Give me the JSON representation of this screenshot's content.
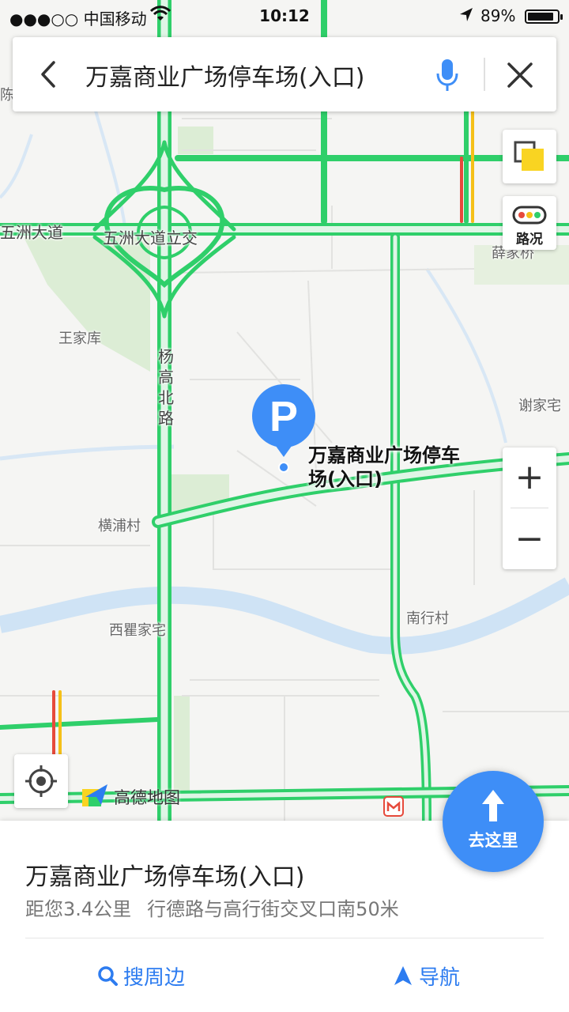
{
  "status_bar": {
    "carrier": "●●●○○ 中国移动",
    "time": "10:12",
    "battery": "89%",
    "battery_level": 0.89
  },
  "search": {
    "query": "万嘉商业广场停车场(入口)"
  },
  "map": {
    "poi_marker_letter": "P",
    "poi_label": "万嘉商业广场停车场(入口)",
    "labels": {
      "wuzhou_dadao": "五洲大道",
      "interchange": "五洲大道立交",
      "xuejiaqiao": "薛家桥",
      "wangjiaku": "王家库",
      "yanggao_beilu": "杨高北路",
      "xiejiazhai": "谢家宅",
      "hengpucun": "横浦村",
      "nanxingcun": "南行村",
      "xiqujiazhai": "西瞿家宅",
      "chen": "陈"
    }
  },
  "controls": {
    "traffic_label": "路况",
    "zoom_in": "+",
    "zoom_out": "−"
  },
  "logo_text": "高德地图",
  "go_button_label": "去这里",
  "panel": {
    "title": "万嘉商业广场停车场(入口)",
    "distance": "距您3.4公里",
    "address": "行德路与高行街交叉口南50米",
    "nearby_label": "搜周边",
    "navigate_label": "导航"
  },
  "colors": {
    "accent_blue": "#2d7cf0",
    "road_green": "#2fcf6a",
    "road_red": "#e64a3b",
    "road_yellow": "#f5c018",
    "water": "#cfe3f5",
    "park": "#dcedd5"
  }
}
